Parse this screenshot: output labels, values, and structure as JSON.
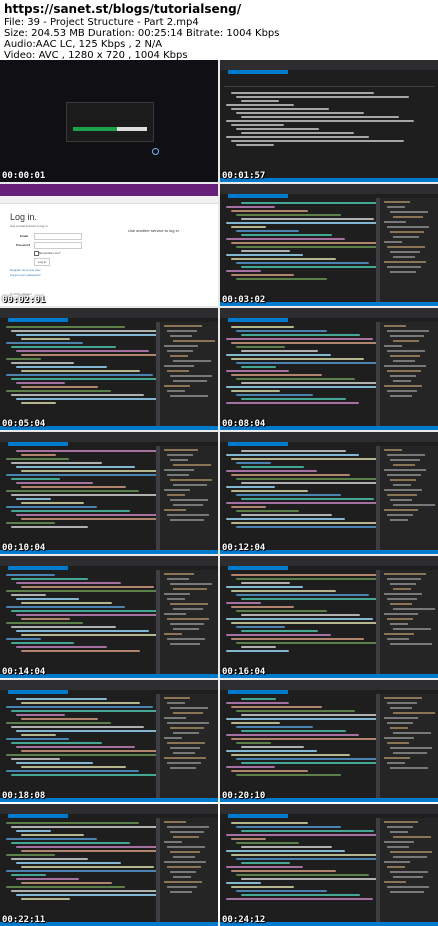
{
  "header": {
    "url": "https://sanet.st/blogs/tutorialseng/",
    "file": "File: 39 - Project Structure - Part 2.mp4",
    "size": "Size: 204.53 MB Duration: 00:25:14 Bitrate: 1004 Kbps",
    "audio": "Audio:AAC LC, 125 Kbps , 2 N/A",
    "video": "Video: AVC , 1280 x 720 , 1004 Kbps"
  },
  "thumbnails": [
    {
      "timestamp": "00:00:01",
      "kind": "loading"
    },
    {
      "timestamp": "00:01:57",
      "kind": "ide-output"
    },
    {
      "timestamp": "00:02:01",
      "kind": "browser-login"
    },
    {
      "timestamp": "00:03:02",
      "kind": "ide-code"
    },
    {
      "timestamp": "00:05:04",
      "kind": "ide-code"
    },
    {
      "timestamp": "00:08:04",
      "kind": "ide-code"
    },
    {
      "timestamp": "00:10:04",
      "kind": "ide-code"
    },
    {
      "timestamp": "00:12:04",
      "kind": "ide-code"
    },
    {
      "timestamp": "00:14:04",
      "kind": "ide-code"
    },
    {
      "timestamp": "00:16:04",
      "kind": "ide-code"
    },
    {
      "timestamp": "00:18:08",
      "kind": "ide-code"
    },
    {
      "timestamp": "00:20:10",
      "kind": "ide-code"
    },
    {
      "timestamp": "00:22:11",
      "kind": "ide-code"
    },
    {
      "timestamp": "00:24:12",
      "kind": "ide-code"
    }
  ],
  "browser": {
    "page_title": "Log in.",
    "subtitle": "Use a local account to log in.",
    "email_label": "Email",
    "password_label": "Password",
    "remember_label": "Remember me?",
    "button_label": "Log in",
    "link_register": "Register as a new user",
    "link_forgot": "Forgot your password?",
    "side_heading": "Use another service to log in.",
    "footer": "© 2019 - Project"
  },
  "colors": {
    "ide_bg": "#1e1e1e",
    "ide_chrome": "#2d2d30",
    "accent": "#007acc",
    "progress": "#1aa34a",
    "banner": "#68217a"
  }
}
